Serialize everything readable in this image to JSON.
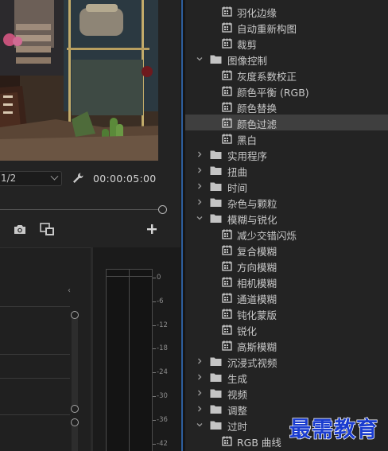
{
  "monitor": {
    "zoom_value": "1/2",
    "duration": "00:00:05:00",
    "icons": {
      "settings": "wrench-icon",
      "export_frame": "camera-icon",
      "insert": "export-frame-icon",
      "add": "plus-icon"
    }
  },
  "timeline": {
    "marker": "‹"
  },
  "audio_meter": {
    "db_labels": [
      "0",
      "-6",
      "-12",
      "-18",
      "-24",
      "-30",
      "-36",
      "-42"
    ]
  },
  "effects_tree": {
    "rows": [
      {
        "label": "羽化边缘",
        "type": "effect",
        "level": 2
      },
      {
        "label": "自动重新构图",
        "type": "effect",
        "level": 2
      },
      {
        "label": "裁剪",
        "type": "effect",
        "level": 2
      },
      {
        "label": "图像控制",
        "type": "folder",
        "level": 1,
        "expanded": true
      },
      {
        "label": "灰度系数校正",
        "type": "effect",
        "level": 2
      },
      {
        "label": "颜色平衡 (RGB)",
        "type": "effect",
        "level": 2
      },
      {
        "label": "颜色替换",
        "type": "effect",
        "level": 2
      },
      {
        "label": "颜色过滤",
        "type": "effect",
        "level": 2,
        "selected": true
      },
      {
        "label": "黑白",
        "type": "effect",
        "level": 2
      },
      {
        "label": "实用程序",
        "type": "folder",
        "level": 1,
        "expanded": false
      },
      {
        "label": "扭曲",
        "type": "folder",
        "level": 1,
        "expanded": false
      },
      {
        "label": "时间",
        "type": "folder",
        "level": 1,
        "expanded": false
      },
      {
        "label": "杂色与颗粒",
        "type": "folder",
        "level": 1,
        "expanded": false
      },
      {
        "label": "模糊与锐化",
        "type": "folder",
        "level": 1,
        "expanded": true
      },
      {
        "label": "减少交错闪烁",
        "type": "effect",
        "level": 2
      },
      {
        "label": "复合模糊",
        "type": "effect",
        "level": 2
      },
      {
        "label": "方向模糊",
        "type": "effect",
        "level": 2
      },
      {
        "label": "相机模糊",
        "type": "effect",
        "level": 2
      },
      {
        "label": "通道模糊",
        "type": "effect",
        "level": 2
      },
      {
        "label": "钝化蒙版",
        "type": "effect",
        "level": 2
      },
      {
        "label": "锐化",
        "type": "effect",
        "level": 2
      },
      {
        "label": "高斯模糊",
        "type": "effect",
        "level": 2
      },
      {
        "label": "沉浸式视频",
        "type": "folder",
        "level": 1,
        "expanded": false
      },
      {
        "label": "生成",
        "type": "folder",
        "level": 1,
        "expanded": false
      },
      {
        "label": "视频",
        "type": "folder",
        "level": 1,
        "expanded": false
      },
      {
        "label": "调整",
        "type": "folder",
        "level": 1,
        "expanded": false
      },
      {
        "label": "过时",
        "type": "folder",
        "level": 1,
        "expanded": true
      },
      {
        "label": "RGB 曲线",
        "type": "effect",
        "level": 2
      }
    ]
  },
  "watermark": "最需教育",
  "colors": {
    "selection": "#3f3f3f",
    "panel_bg": "#232323",
    "accent_divider": "#2e5f9e",
    "watermark": "#1a3ccf"
  }
}
